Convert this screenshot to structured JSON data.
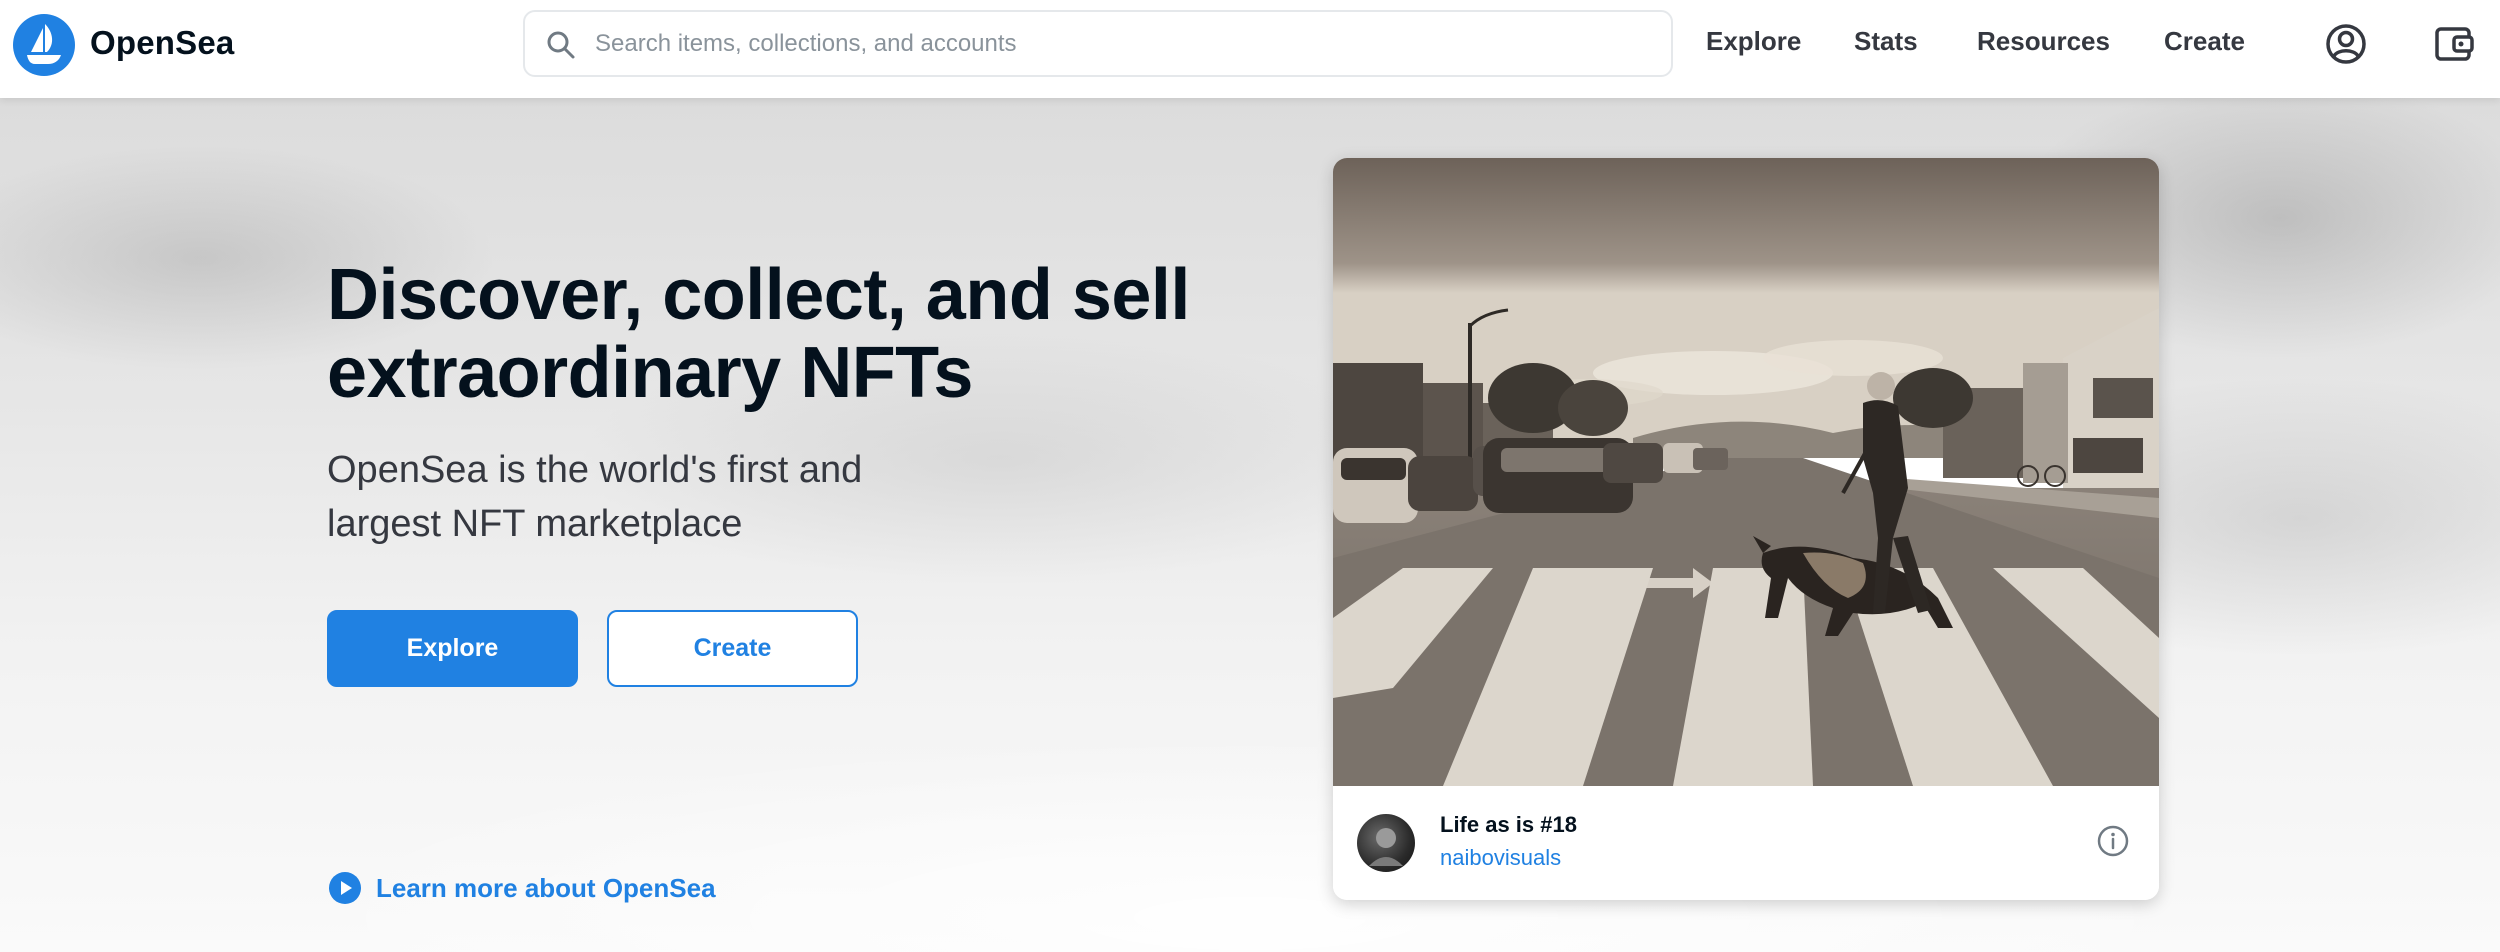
{
  "brand": {
    "name": "OpenSea",
    "logo_icon": "opensea-ship-logo",
    "accent_color": "#2081e2"
  },
  "search": {
    "placeholder": "Search items, collections, and accounts",
    "value": "",
    "icon": "search-icon"
  },
  "nav": {
    "items": [
      {
        "label": "Explore"
      },
      {
        "label": "Stats"
      },
      {
        "label": "Resources"
      },
      {
        "label": "Create"
      }
    ],
    "profile_icon": "account-circle-icon",
    "wallet_icon": "wallet-icon"
  },
  "hero": {
    "title": "Discover, collect, and sell extraordinary NFTs",
    "subtitle": "OpenSea is the world's first and largest NFT marketplace",
    "primary_button": "Explore",
    "secondary_button": "Create",
    "learn_more": "Learn more about OpenSea",
    "learn_more_icon": "play-circle-icon"
  },
  "featured_nft": {
    "name": "Life as is #18",
    "creator": "naibovisuals",
    "image_description_icon": "street-crosswalk-photo",
    "info_icon": "info-icon"
  }
}
